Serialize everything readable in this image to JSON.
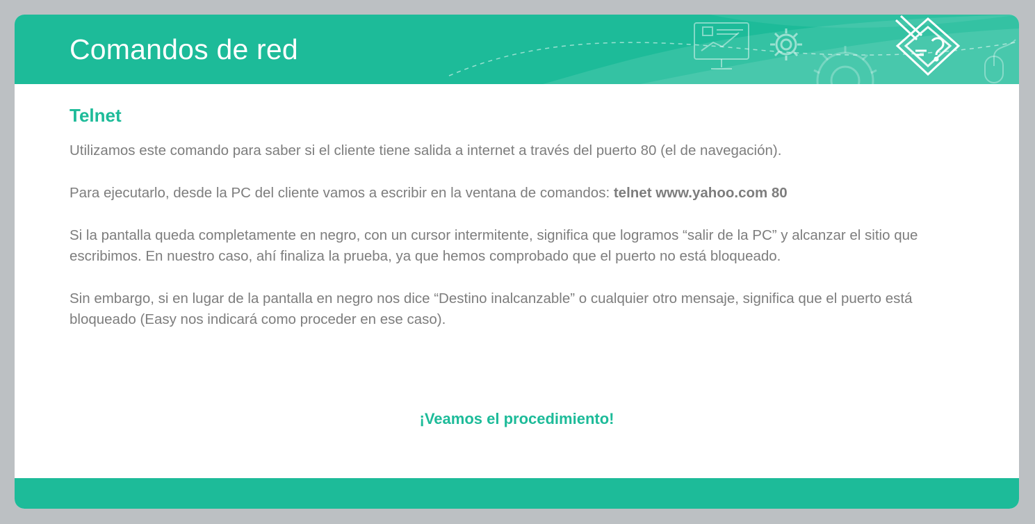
{
  "header": {
    "title": "Comandos de red",
    "colors": {
      "accent": "#1dbb99",
      "text_gray": "#7d7d7d",
      "background": "#bcc0c3"
    },
    "icons": [
      "monitor-chart-icon",
      "gear-icon",
      "large-gear-icon",
      "pencil-diamond-logo-icon",
      "mouse-icon"
    ]
  },
  "content": {
    "heading": "Telnet",
    "p1": "Utilizamos este comando para saber si el cliente tiene salida a internet a través del puerto 80 (el de navegación).",
    "p2_prefix": "Para ejecutarlo, desde la PC del cliente vamos a escribir en la ventana de comandos: ",
    "p2_command": "telnet www.yahoo.com  80",
    "p3": "Si la pantalla queda completamente en negro, con un cursor intermitente, significa que logramos “salir de la PC” y alcanzar el sitio que escribimos. En nuestro caso, ahí finaliza la prueba, ya que hemos comprobado que el puerto no está bloqueado.",
    "p4": "Sin embargo, si en lugar de la pantalla en negro nos dice “Destino inalcanzable” o cualquier otro mensaje, significa que el puerto está bloqueado (Easy nos indicará como proceder en ese caso)."
  },
  "cta": "¡Veamos el procedimiento!"
}
